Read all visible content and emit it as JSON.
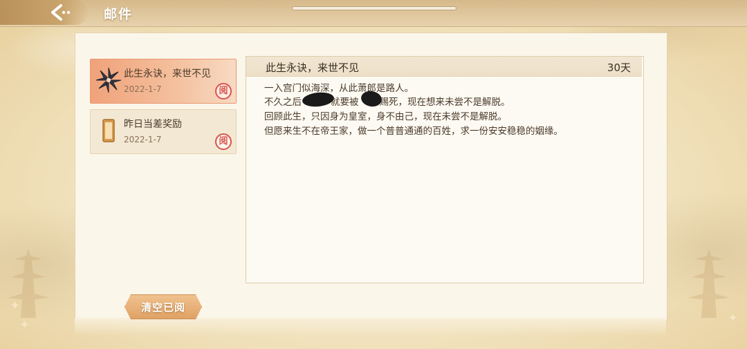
{
  "header": {
    "title": "邮件",
    "back_icon": "back-arrow-icon"
  },
  "mail_list": [
    {
      "title": "此生永诀，来世不见",
      "date": "2022-1-7",
      "icon": "shuriken-icon",
      "status": "阅",
      "selected": true
    },
    {
      "title": "昨日当差奖励",
      "date": "2022-1-7",
      "icon": "scroll-icon",
      "status": "阅",
      "selected": false
    }
  ],
  "detail": {
    "title": "此生永诀，来世不见",
    "days": "30天",
    "lines": [
      "一入宫门似海深，从此萧郎是路人。",
      {
        "before": "不久之后",
        "middle": "就要被",
        "after": "赐死，现在想来未尝不是解脱。"
      },
      "回顾此生，只因身为皇室，身不由己，现在未尝不是解脱。",
      "但愿来生不在帝王家，做一个普普通通的百姓，求一份安安稳稳的姻缘。"
    ]
  },
  "footer": {
    "clear_read_label": "清空已阅"
  },
  "colors": {
    "accent": "#f0a27a",
    "stamp": "#d9534f",
    "button": "#e0a265"
  }
}
